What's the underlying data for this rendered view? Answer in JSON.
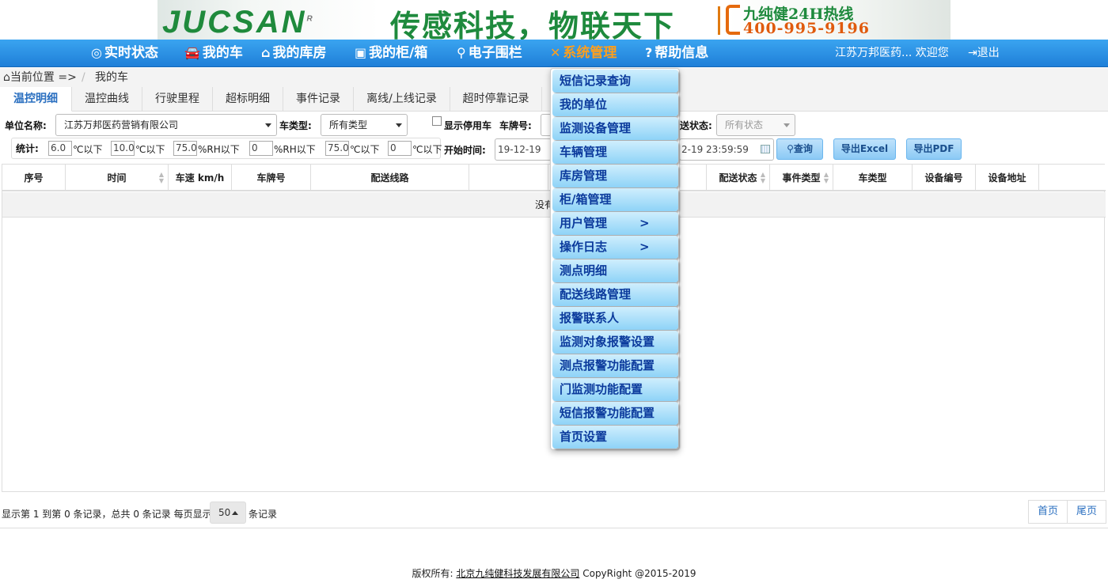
{
  "banner": {
    "logo": "JUCSAN",
    "logo_mark": "R",
    "slogan": "传感科技，物联天下",
    "hotline_label": "九纯健24H热线",
    "hotline_number": "400-995-9196"
  },
  "nav": {
    "items": [
      {
        "icon": "◎",
        "label": "实时状态"
      },
      {
        "icon": "🚘",
        "label": "我的车"
      },
      {
        "icon": "⌂",
        "label": "我的库房"
      },
      {
        "icon": "▣",
        "label": "我的柜/箱"
      },
      {
        "icon": "⚲",
        "label": "电子围栏"
      },
      {
        "icon": "✕",
        "label": "系统管理"
      },
      {
        "icon": "?",
        "label": "帮助信息"
      }
    ],
    "active_color": "#ff9f1c",
    "user_text": "江苏万邦医药... 欢迎您",
    "logout_label": "退出"
  },
  "breadcrumb": {
    "prefix": "当前位置 =>",
    "sep": "/",
    "current": "我的车"
  },
  "tabs": [
    "温控明细",
    "温控曲线",
    "行驶里程",
    "超标明细",
    "事件记录",
    "离线/上线记录",
    "超时停靠记录"
  ],
  "filters": {
    "unit_label": "单位名称:",
    "unit_value": "江苏万邦医药营销有限公司",
    "car_type_label": "车类型:",
    "car_type_value": "所有类型",
    "show_disabled_label": "显示停用车",
    "plate_label": "车牌号:",
    "status_label_tail": "送状态:",
    "status_value": "所有状态",
    "stats_label": "统计:",
    "stats": [
      {
        "value": "6.0",
        "unit": "℃以下"
      },
      {
        "value": "10.0",
        "unit": "℃以下"
      },
      {
        "value": "75.0",
        "unit": "%RH以下"
      },
      {
        "value": "0",
        "unit": "%RH以下"
      },
      {
        "value": "75.0",
        "unit": "℃以下"
      },
      {
        "value": "0",
        "unit": "℃以下"
      }
    ],
    "start_label": "开始时间:",
    "start_value": "19-12-19 00",
    "end_value": "2-19 23:59:59",
    "query_label": "查询",
    "excel_label": "导出Excel",
    "pdf_label": "导出PDF"
  },
  "table": {
    "columns": [
      "序号",
      "时间",
      "车速 km/h",
      "车牌号",
      "配送线路",
      "",
      "",
      "配送状态",
      "事件类型",
      "车类型",
      "设备编号",
      "设备地址"
    ],
    "empty_text": "没有找到"
  },
  "pager": {
    "info": "显示第 1 到第 0 条记录，总共 0 条记录  每页显示",
    "page_size": "50",
    "records_suffix": "条记录",
    "first": "首页",
    "last": "尾页"
  },
  "footer": {
    "prefix": "版权所有:",
    "company": "北京九纯健科技发展有限公司",
    "copyright": "CopyRight @2015-2019"
  },
  "dropdown": {
    "items": [
      {
        "label": "短信记录查询",
        "arrow": ""
      },
      {
        "label": "我的单位",
        "arrow": ""
      },
      {
        "label": "监测设备管理",
        "arrow": ""
      },
      {
        "label": "车辆管理",
        "arrow": ""
      },
      {
        "label": "库房管理",
        "arrow": ""
      },
      {
        "label": "柜/箱管理",
        "arrow": ""
      },
      {
        "label": "用户管理",
        "arrow": ">"
      },
      {
        "label": "操作日志",
        "arrow": ">"
      },
      {
        "label": "测点明细",
        "arrow": ""
      },
      {
        "label": "配送线路管理",
        "arrow": ""
      },
      {
        "label": "报警联系人",
        "arrow": ""
      },
      {
        "label": "监测对象报警设置",
        "arrow": ""
      },
      {
        "label": "测点报警功能配置",
        "arrow": ""
      },
      {
        "label": "门监测功能配置",
        "arrow": ""
      },
      {
        "label": "短信报警功能配置",
        "arrow": ""
      },
      {
        "label": "首页设置",
        "arrow": ""
      }
    ]
  }
}
